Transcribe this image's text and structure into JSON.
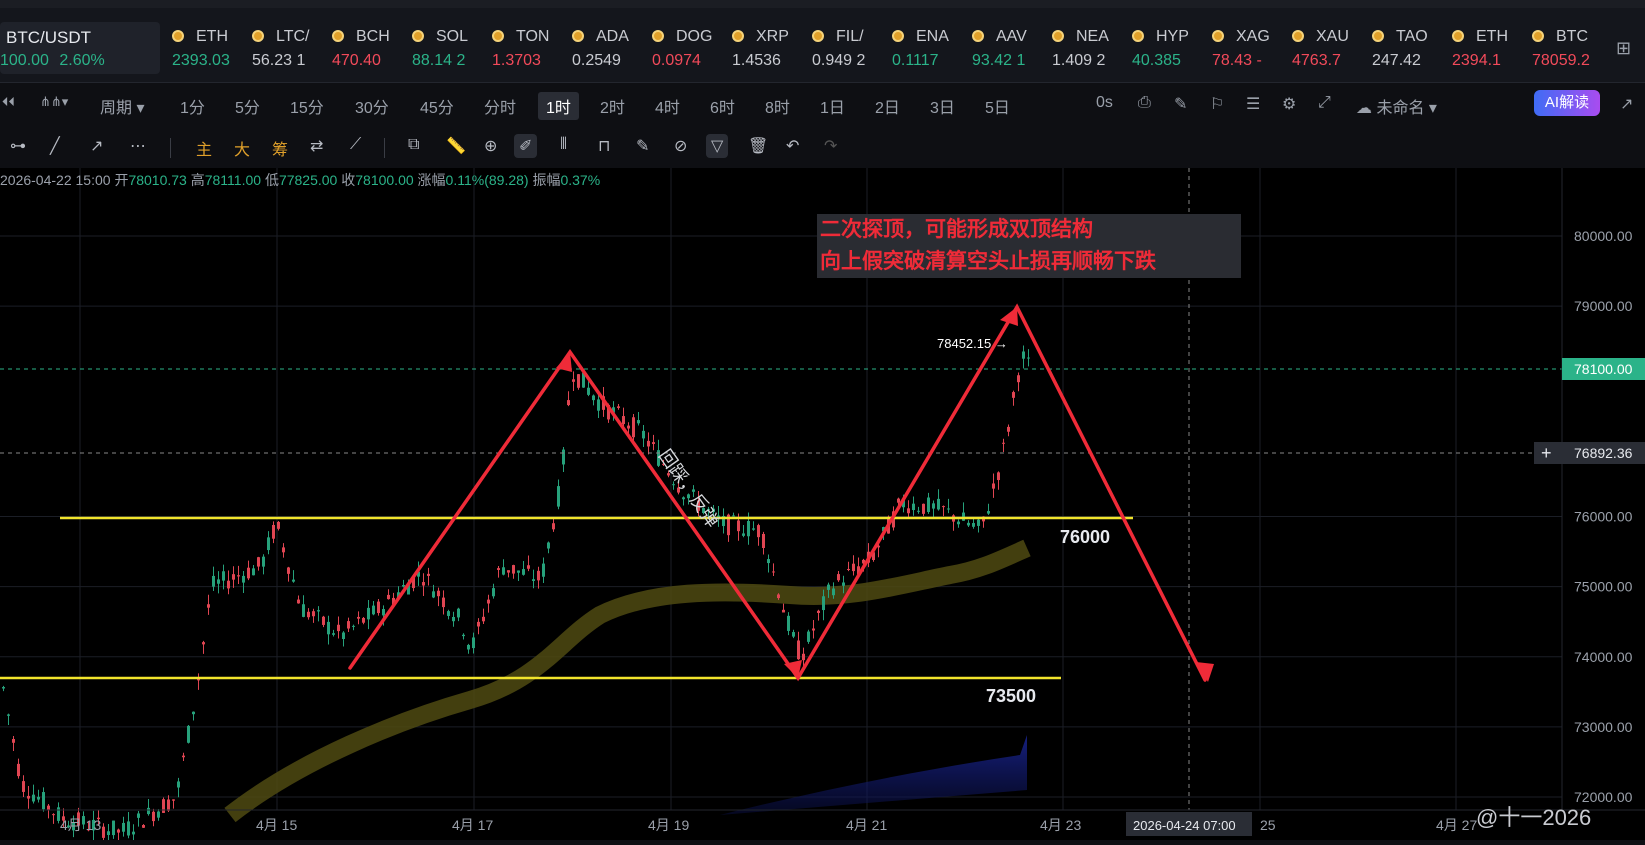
{
  "header": {
    "pair": {
      "name": "BTC/USDT",
      "price": "100.00",
      "change": "2.60%"
    },
    "tickers": [
      {
        "sym": "ETH",
        "val": "2393.03",
        "color": "#2bb389"
      },
      {
        "sym": "LTC/",
        "val": "56.23 1",
        "color": "#c9cbd1"
      },
      {
        "sym": "BCH",
        "val": "470.40",
        "color": "#f24a5a"
      },
      {
        "sym": "SOL",
        "val": "88.14 2",
        "color": "#2bb389"
      },
      {
        "sym": "TON",
        "val": "1.3703",
        "color": "#f24a5a"
      },
      {
        "sym": "ADA",
        "val": "0.2549",
        "color": "#c9cbd1"
      },
      {
        "sym": "DOG",
        "val": "0.0974",
        "color": "#f24a5a"
      },
      {
        "sym": "XRP",
        "val": "1.4536",
        "color": "#c9cbd1"
      },
      {
        "sym": "FIL/",
        "val": "0.949 2",
        "color": "#c9cbd1"
      },
      {
        "sym": "ENA",
        "val": "0.1117",
        "color": "#2bb389"
      },
      {
        "sym": "AAV",
        "val": "93.42 1",
        "color": "#2bb389"
      },
      {
        "sym": "NEA",
        "val": "1.409 2",
        "color": "#c9cbd1"
      },
      {
        "sym": "HYP",
        "val": "40.385",
        "color": "#2bb389"
      },
      {
        "sym": "XAG",
        "val": "78.43 -",
        "color": "#f24a5a"
      },
      {
        "sym": "XAU",
        "val": "4763.7",
        "color": "#f24a5a"
      },
      {
        "sym": "TAO",
        "val": "247.42",
        "color": "#c9cbd1"
      },
      {
        "sym": "ETH",
        "val": "2394.1",
        "color": "#f24a5a"
      },
      {
        "sym": "BTC",
        "val": "78059.2",
        "color": "#f24a5a"
      }
    ]
  },
  "timeframes": {
    "period_label": "周期",
    "items": [
      "1分",
      "5分",
      "15分",
      "30分",
      "45分",
      "分时",
      "1时",
      "2时",
      "4时",
      "6时",
      "8时",
      "1日",
      "2日",
      "3日",
      "5日"
    ],
    "active": "1时",
    "countdown": "0s",
    "layout_name": "未命名",
    "ai_label": "AI解读"
  },
  "toolbar": {
    "zhu": "主",
    "da": "大",
    "chou": "筹"
  },
  "ohlc": {
    "time": "2026-04-22 15:00",
    "open_k": "开",
    "open": "78010.73",
    "high_k": "高",
    "high": "78111.00",
    "low_k": "低",
    "low": "77825.00",
    "close_k": "收",
    "close": "78100.00",
    "chg_k": "涨幅",
    "chg": "0.11%(89.28)",
    "amp_k": "振幅",
    "amp": "0.37%"
  },
  "annotations": {
    "line1": "二次探顶，可能形成双顶结构",
    "line2": "向上假突破清算空头止损再顺畅下跌",
    "diag_text": "回踩，反弹",
    "level_76000": "76000",
    "level_73500": "73500",
    "peak_label": "78452.15 →"
  },
  "price_axis": {
    "labels": [
      "80000.00",
      "79000.00",
      "78100.00",
      "76892.36",
      "76000.00",
      "75000.00",
      "74000.00",
      "73000.00",
      "72000.00"
    ],
    "current": "78100.00",
    "cursor": "76892.36"
  },
  "time_axis": {
    "labels": [
      "4月 13",
      "4月 15",
      "4月 17",
      "4月 19",
      "4月 21",
      "4月 23",
      "25",
      "4月 27"
    ],
    "cursor": "2026-04-24 07:00"
  },
  "watermark": "@十一2026",
  "chart_data": {
    "type": "candlestick",
    "x_range": [
      "4月 13",
      "4月 27"
    ],
    "y_range": [
      72000,
      80500
    ],
    "levels": [
      {
        "label": "76000",
        "value": 76000,
        "color": "#f1e42c"
      },
      {
        "label": "73500",
        "value": 73500,
        "color": "#f1e42c"
      }
    ],
    "last_price": 78100.0,
    "peak_marker": 78452.15,
    "candles": []
  }
}
